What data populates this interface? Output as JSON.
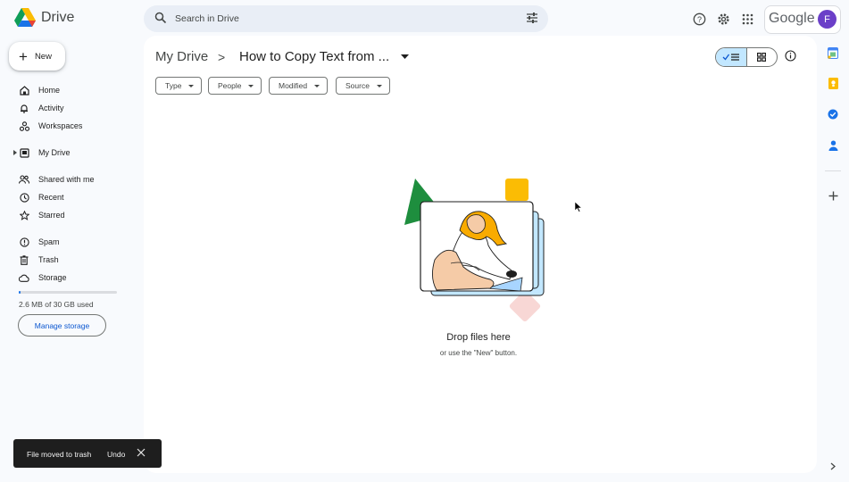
{
  "app": {
    "name": "Drive"
  },
  "search": {
    "placeholder": "Search in Drive"
  },
  "header": {
    "google_label": "Google",
    "avatar_letter": "F"
  },
  "new_button": {
    "label": "New"
  },
  "nav": {
    "home": "Home",
    "activity": "Activity",
    "workspaces": "Workspaces",
    "my_drive": "My Drive",
    "shared": "Shared with me",
    "recent": "Recent",
    "starred": "Starred",
    "spam": "Spam",
    "trash": "Trash",
    "storage": "Storage"
  },
  "storage": {
    "used_text": "2.6 MB of 30 GB used",
    "used_fraction": 0.0001,
    "manage_label": "Manage storage"
  },
  "breadcrumb": {
    "root": "My Drive",
    "separator": ">",
    "current": "How to Copy Text from ..."
  },
  "filters": [
    "Type",
    "People",
    "Modified",
    "Source"
  ],
  "empty_state": {
    "title": "Drop files here",
    "subtitle": "or use the \"New\" button."
  },
  "snackbar": {
    "message": "File moved to trash",
    "action": "Undo"
  },
  "colors": {
    "accent": "#0b57d0",
    "selected_toggle": "#c2e7ff",
    "avatar": "#6b3fc8",
    "snackbar_bg": "#1e1e1e"
  },
  "icons": [
    "drive-logo-icon",
    "search-icon",
    "tune-icon",
    "help-icon",
    "settings-icon",
    "apps-grid-icon",
    "calendar-icon",
    "keep-icon",
    "tasks-icon",
    "contacts-icon",
    "add-icon",
    "close-icon",
    "info-icon"
  ]
}
